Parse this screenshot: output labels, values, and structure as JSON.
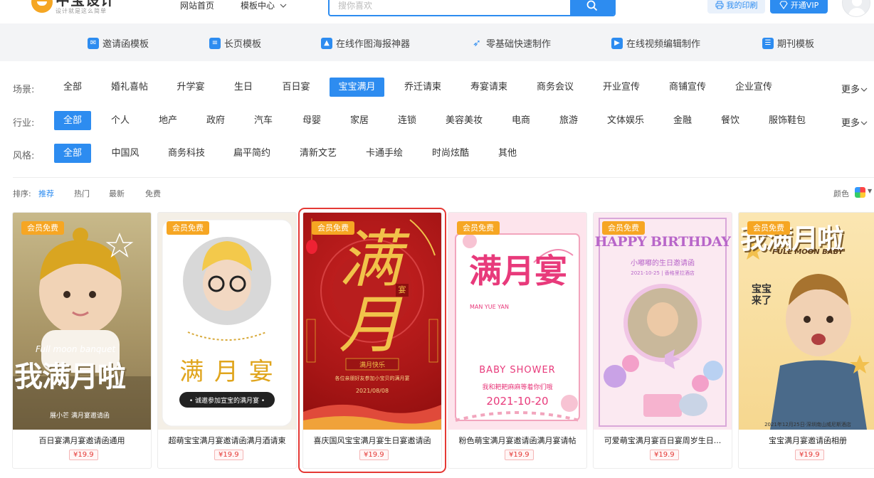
{
  "header": {
    "logo_text": "中宝设计",
    "logo_slogan": "设计就是这么简单",
    "nav": [
      "网站首页",
      "模板中心"
    ],
    "search_placeholder": "搜你喜欢",
    "my_print": "我的印刷",
    "open_vip": "开通VIP"
  },
  "categories": [
    "邀请函模板",
    "长页模板",
    "在线作图海报神器",
    "零基础快速制作",
    "在线视频编辑制作",
    "期刊模板"
  ],
  "filters": {
    "scene": {
      "label": "场景:",
      "items": [
        "全部",
        "婚礼喜帖",
        "升学宴",
        "生日",
        "百日宴",
        "宝宝满月",
        "乔迁请柬",
        "寿宴请柬",
        "商务会议",
        "开业宣传",
        "商铺宣传",
        "企业宣传"
      ],
      "active": "宝宝满月",
      "more": "更多"
    },
    "industry": {
      "label": "行业:",
      "items": [
        "全部",
        "个人",
        "地产",
        "政府",
        "汽车",
        "母婴",
        "家居",
        "连锁",
        "美容美妆",
        "电商",
        "旅游",
        "文体娱乐",
        "金融",
        "餐饮",
        "服饰鞋包"
      ],
      "active": "全部",
      "more": "更多"
    },
    "style": {
      "label": "风格:",
      "items": [
        "全部",
        "中国风",
        "商务科技",
        "扁平简约",
        "清新文艺",
        "卡通手绘",
        "时尚炫酷",
        "其他"
      ],
      "active": "全部"
    }
  },
  "sort": {
    "label": "排序:",
    "options": [
      "推荐",
      "热门",
      "最新",
      "免费"
    ],
    "active": "推荐",
    "color_label": "颜色"
  },
  "cards": [
    {
      "badge": "会员免费",
      "title": "百日宴满月宴邀请函通用",
      "price": "¥19.9",
      "art": "Full moon banquet",
      "art2": "我满月啦",
      "art3": "展小芒 满月宴邀请函"
    },
    {
      "badge": "会员免费",
      "title": "超萌宝宝满月宴邀请函满月酒请柬",
      "price": "¥19.9",
      "art": "满 月 宴",
      "art2": "• 诚邀参加宣宝的满月宴 •"
    },
    {
      "badge": "会员免费",
      "title": "喜庆国风宝宝满月宴生日宴邀请函",
      "price": "¥19.9",
      "art": "满月",
      "art2": "宴",
      "art3": "满月快乐",
      "art4": "各位亲朋好友参加小宝贝的满月宴",
      "art5": "2021/08/08"
    },
    {
      "badge": "会员免费",
      "title": "粉色萌宝满月宴邀请函满月宴请帖",
      "price": "¥19.9",
      "art": "满月宴",
      "art2": "MAN YUE YAN",
      "art3": "BABY SHOWER",
      "art4": "我和耙耙麻麻等着你们哦",
      "art5": "2021-10-20"
    },
    {
      "badge": "会员免费",
      "title": "可爱萌宝满月宴百日宴周岁生日...",
      "price": "¥19.9",
      "art": "HAPPY BIRTHDAY",
      "art2": "小嘟嘟的生日邀请函",
      "art3": "2021-10-25 | 香格里拉酒店"
    },
    {
      "badge": "会员免费",
      "title": "宝宝满月宴邀请函相册",
      "price": "¥19.9",
      "art": "我满月啦",
      "art2": "FULL MOON BABY",
      "art3": "宝宝来了",
      "art4": "2021年12月25日·深圳南山威尼斯酒店"
    }
  ],
  "selected_card": 2,
  "colors": {
    "accent": "#2d8cf0",
    "badge": "#f6a623",
    "price": "#e53935",
    "selection": "#e53935"
  }
}
